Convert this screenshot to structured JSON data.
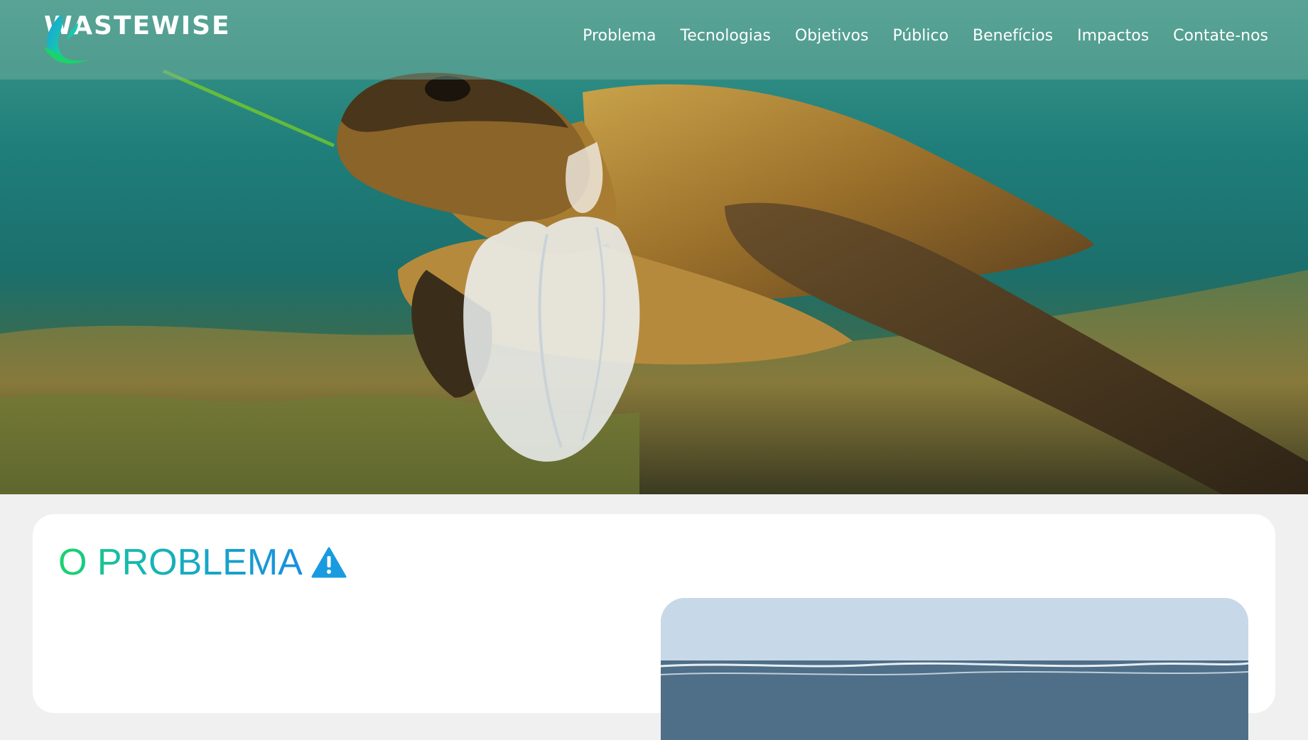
{
  "brand": {
    "name": "WASTEWISE"
  },
  "nav": {
    "items": [
      {
        "label": "Problema"
      },
      {
        "label": "Tecnologias"
      },
      {
        "label": "Objetivos"
      },
      {
        "label": "Público"
      },
      {
        "label": "Benefícios"
      },
      {
        "label": "Impactos"
      },
      {
        "label": "Contate-nos"
      }
    ]
  },
  "section": {
    "title": "O PROBLEMA",
    "icon": "warning-icon"
  },
  "colors": {
    "title_gradient_start": "#1ad36a",
    "title_gradient_end": "#1a8ee0",
    "warning_icon": "#1a9be0",
    "card_bg": "#ffffff",
    "page_bg": "#f0f0f0"
  }
}
